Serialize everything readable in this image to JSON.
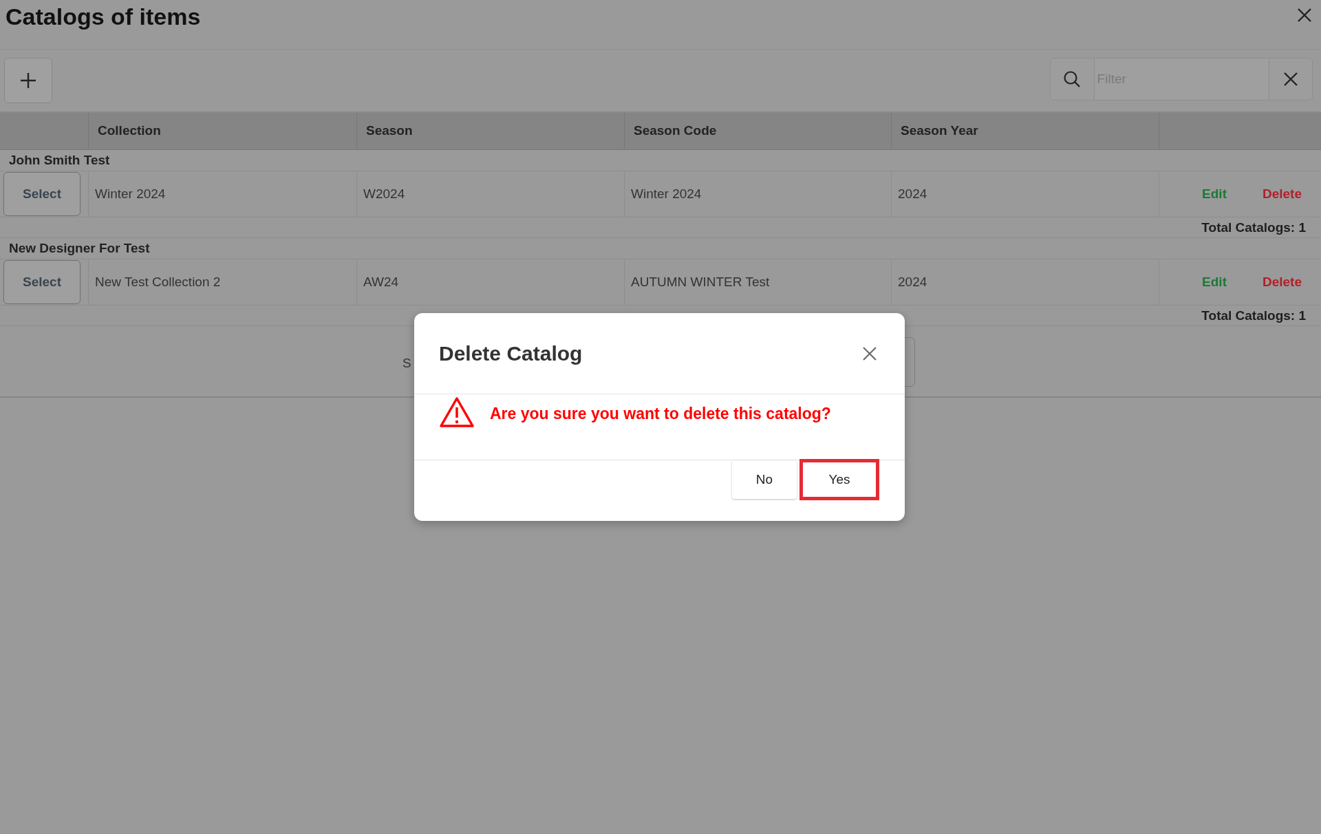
{
  "window": {
    "title": "Catalogs of items"
  },
  "toolbar": {
    "filter": {
      "placeholder": "Filter"
    }
  },
  "table": {
    "columns": [
      "Collection",
      "Season",
      "Season Code",
      "Season Year"
    ],
    "groups": [
      {
        "name": "John Smith Test",
        "rows": [
          {
            "select": "Select",
            "cells": [
              "Winter 2024",
              "W2024",
              "Winter 2024",
              "2024"
            ],
            "edit": "Edit",
            "delete": "Delete"
          }
        ],
        "total": "Total Catalogs: 1"
      },
      {
        "name": "New Designer For Test",
        "rows": [
          {
            "select": "Select",
            "cells": [
              "New Test Collection 2",
              "AW24",
              "AUTUMN WINTER Test",
              "2024"
            ],
            "edit": "Edit",
            "delete": "Delete"
          }
        ],
        "total": "Total Catalogs: 1"
      }
    ]
  },
  "pager": {
    "text": "S"
  },
  "dialog": {
    "title": "Delete Catalog",
    "message": "Are you sure you want to delete this catalog?",
    "buttons": [
      {
        "label": "No",
        "highlighted": false
      },
      {
        "label": "Yes",
        "highlighted": true
      }
    ]
  }
}
